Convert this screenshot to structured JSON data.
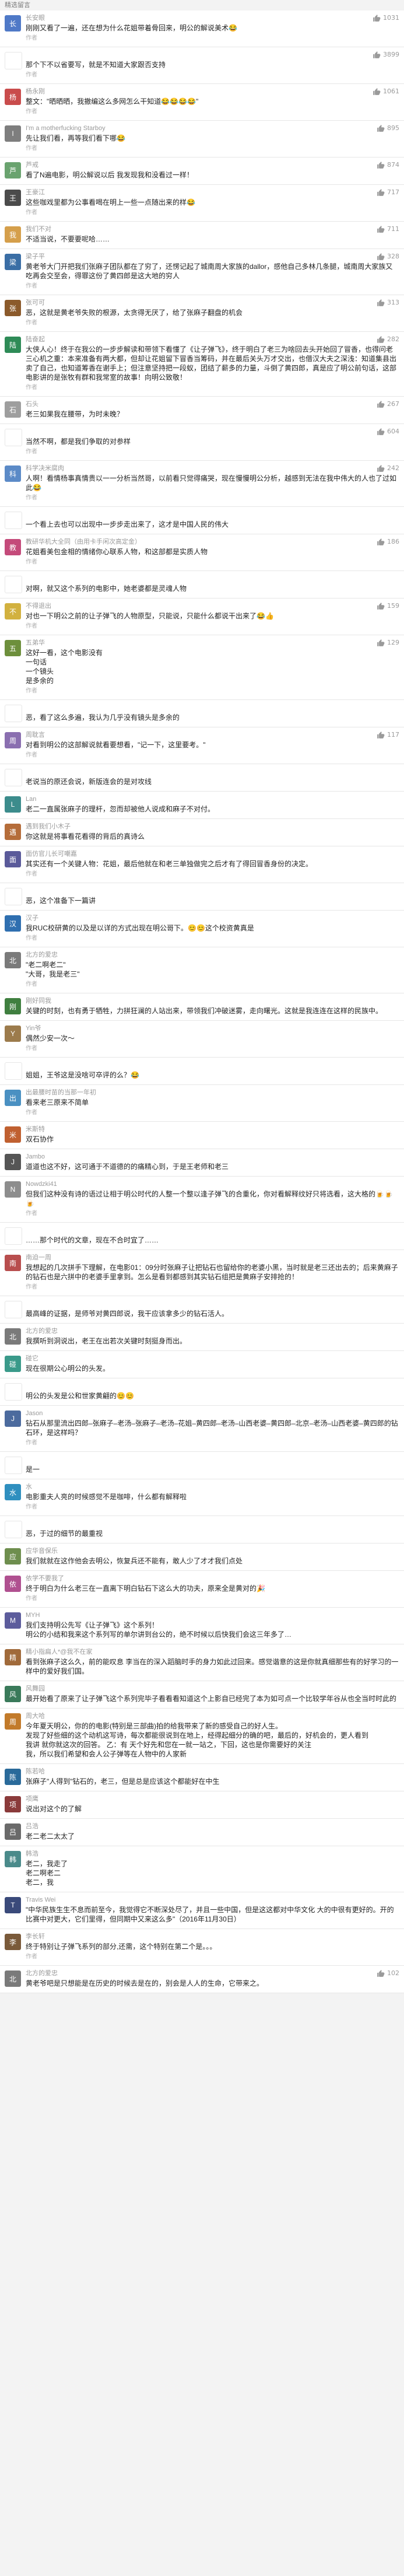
{
  "header": {
    "label": "精选留言"
  },
  "comments": [
    {
      "name": "长安眼",
      "likes": "1031",
      "text": "刚刚又看了一遍，还在想为什么花姐带着骨回来，明公的解说美术😂",
      "reply": "作者",
      "avatar_color": "#4f79c7",
      "avatar_char": "长"
    },
    {
      "name": "",
      "likes": "3899",
      "text": "那个下不以省要写，就是不知道大家跟否支持",
      "reply": "作者",
      "avatar_color": "#ffffff",
      "avatar_char": ""
    },
    {
      "name": "杨永刚",
      "likes": "1061",
      "text": "整文：\"晒晒晒，我撤编这么多网怎么干知道😂😂😂😂\"",
      "reply": "作者",
      "avatar_color": "#c94c4c",
      "avatar_char": "杨"
    },
    {
      "name": "I'm a motherfucking Starboy",
      "likes": "895",
      "text": "先让我们看，再等我们看下哪😂",
      "reply": "作者",
      "avatar_color": "#7e7e7e",
      "avatar_char": "I"
    },
    {
      "name": "芦戒",
      "likes": "874",
      "text": "看了N遍电影，明公解说以后 我发现我和没看过一样！",
      "reply": "",
      "avatar_color": "#6aa36f",
      "avatar_char": "芦"
    },
    {
      "name": "王豪江",
      "likes": "717",
      "text": "这些咖戏里都为公事看喝在明上一些一点随出来的样😂",
      "reply": "作者",
      "avatar_color": "#4b4b4b",
      "avatar_char": "王"
    },
    {
      "name": "我们不对",
      "likes": "711",
      "text": "不适当说，不要要呢哈……",
      "reply": "",
      "avatar_color": "#d59f4b",
      "avatar_char": "我"
    },
    {
      "name": "梁子平",
      "likes": "328",
      "text": "黄老爷大门开把我们张麻子团队都在了穷了，还愣记起了城南周大家族的dallor，感他自己多林几条腿，城南周大家族又吃再会交至会，得罪这份了黄四郎是这大地的穷人",
      "reply": "作者",
      "avatar_color": "#3a6ea5",
      "avatar_char": "梁"
    },
    {
      "name": "张可可",
      "likes": "313",
      "text": "恶，这就是黄老爷失败的根源，太贪得无厌了，给了张麻子翻盘的机会",
      "reply": "作者",
      "avatar_color": "#8b5a2b",
      "avatar_char": "张"
    },
    {
      "name": "陆奋起",
      "likes": "282",
      "text": "大侠人心！终于在我公的一步步解读和带领下看懂了《让子弹飞》，终于明白了老三为啥回去头开始回了冒香，也得问老三心机之重：本来准备有两大都，但却让花姐留下冒香当筹码，并在最后关头万才交出，也借汉大夫之深浅：知道集县出卖了自己，也知道筹香在谢手上；但注意坚持把一段蚁，团结了薪多的力量，斗倒了黄四郎，真是应了明公前句话，这部电影讲的是张牧有群和我常室的故事！向明公致敬！",
      "reply": "作者",
      "avatar_color": "#2e8b57",
      "avatar_char": "陆"
    },
    {
      "name": "石头",
      "likes": "267",
      "text": "老三如果我在腰带，为时未晚？",
      "reply": "",
      "avatar_color": "#9e9e9e",
      "avatar_char": "石"
    },
    {
      "name": "",
      "likes": "604",
      "text": "当然不啊，都是我们争取的对参样",
      "reply": "作者",
      "avatar_color": "#ffffff",
      "avatar_char": ""
    },
    {
      "name": "科学决米腐肉",
      "likes": "242",
      "text": "人啊！看情杨事真情贵以一一分析当然哥，以前看只觉得痛哭，现在慢慢明公分析，越感到无法在我中伟大的人也了过如此😂",
      "reply": "作者",
      "avatar_color": "#5b8ac7",
      "avatar_char": "科"
    },
    {
      "name": "",
      "likes": "",
      "text": "一个看上去也可以出现中一步步走出来了，这才是中国人民的伟大",
      "reply": "",
      "avatar_color": "#ffffff",
      "avatar_char": ""
    },
    {
      "name": "教研华机大全同（由用卡手闲次高定金）",
      "likes": "186",
      "text": "花姐看美包金相的情绪你心联系人物，和这部都是实质人物",
      "reply": "作者",
      "avatar_color": "#c44a7a",
      "avatar_char": "教"
    },
    {
      "name": "",
      "likes": "",
      "text": "对啊，就又这个系列的电影中，她老婆都是灵魂人物",
      "reply": "",
      "avatar_color": "#ffffff",
      "avatar_char": ""
    },
    {
      "name": "不得退出",
      "likes": "159",
      "text": "对也一下明公之前的让子弹飞的人物原型，只能说，只能什么都说干出来了😂👍",
      "reply": "作者",
      "avatar_color": "#d2b13f",
      "avatar_char": "不"
    },
    {
      "name": "五弟华",
      "likes": "129",
      "text": "这好一看，这个电影没有\n一句话\n一个镜头\n是多余的",
      "reply": "作者",
      "avatar_color": "#6d8f3c",
      "avatar_char": "五"
    },
    {
      "name": "",
      "likes": "",
      "text": "恶，看了这么多遍，我认为几乎没有镜头是多余的",
      "reply": "",
      "avatar_color": "#ffffff",
      "avatar_char": ""
    },
    {
      "name": "周耽言",
      "likes": "117",
      "text": "对看到明公的这部解说就看要想看，\"记一下，这里要考。\"",
      "reply": "作者",
      "avatar_color": "#8a6fb0",
      "avatar_char": "周"
    },
    {
      "name": "",
      "likes": "",
      "text": "老说当的原还会说，新版连会的是对攻线",
      "reply": "",
      "avatar_color": "#ffffff",
      "avatar_char": ""
    },
    {
      "name": "Lan",
      "likes": "",
      "text": "老二一直属张麻子的理杆，忽而却被他人说成和麻子不对付。",
      "reply": "",
      "avatar_color": "#3c8c8c",
      "avatar_char": "L"
    },
    {
      "name": "遇到我们小木子",
      "likes": "",
      "text": "你这就是将事看花看得的背后的真诗么",
      "reply": "",
      "avatar_color": "#b56d3a",
      "avatar_char": "遇"
    },
    {
      "name": "面仿官儿长可嘲嘉",
      "likes": "",
      "text": "其实还有一个关键人物：花姐，最后他就在和老三单独做完之后才有了得回冒香身份的决定。",
      "reply": "作者",
      "avatar_color": "#5a5a9a",
      "avatar_char": "面"
    },
    {
      "name": "",
      "likes": "",
      "text": "恶，这个准备下一篇讲",
      "reply": "",
      "avatar_color": "#ffffff",
      "avatar_char": ""
    },
    {
      "name": "汉子",
      "likes": "",
      "text": "我RUC校研黄的以及是以详的方式出现在明公哥下。😊😊这个校资黄真是",
      "reply": "作者",
      "avatar_color": "#2f6fb0",
      "avatar_char": "汉"
    },
    {
      "name": "北方的爱忠",
      "likes": "",
      "text": "\"老二啊老二\"\n\"大哥，我是老三\"",
      "reply": "作者",
      "avatar_color": "#7a7a7a",
      "avatar_char": "北"
    },
    {
      "name": "刚好同我",
      "likes": "",
      "text": "关键的时刻，也有勇于牺牲，力拼狂澜的人站出来，带领我们冲破迷雾，走向曙光。这就是我连连在这样的民族中。",
      "reply": "",
      "avatar_color": "#3f7f3f",
      "avatar_char": "刚"
    },
    {
      "name": "Yin爷",
      "likes": "",
      "text": "偶然少安一次～",
      "reply": "作者",
      "avatar_color": "#9c7b4c",
      "avatar_char": "Y"
    },
    {
      "name": "",
      "likes": "",
      "text": "姐姐，王爷这是没啥可卒评的么？😂",
      "reply": "",
      "avatar_color": "#ffffff",
      "avatar_char": ""
    },
    {
      "name": "出最腰时苗的当那一年初",
      "likes": "",
      "text": "看来老三原来不简单",
      "reply": "作者",
      "avatar_color": "#4a90c2",
      "avatar_char": "出"
    },
    {
      "name": "米斯特",
      "likes": "",
      "text": "双石协作",
      "reply": "",
      "avatar_color": "#c06030",
      "avatar_char": "米"
    },
    {
      "name": "Jambo",
      "likes": "",
      "text": "道道也这不好，这可通于不道德的的痛精心到，于是王老师和老三",
      "reply": "",
      "avatar_color": "#555555",
      "avatar_char": "J"
    },
    {
      "name": "Nowdzki41",
      "likes": "",
      "text": "但我们这种没有诗的语过让相于明公时代的人整一个整以逢子弹飞的合重化，你对看解释纹好只将选看，这大格的🍺🍺🍺",
      "reply": "作者",
      "avatar_color": "#8d8d8d",
      "avatar_char": "N"
    },
    {
      "name": "",
      "likes": "",
      "text": "……那个时代的文章，现在不合时宜了……",
      "reply": "",
      "avatar_color": "#ffffff",
      "avatar_char": ""
    },
    {
      "name": "南迫一周",
      "likes": "",
      "text": "我想起的几次拼手下理解，在电影01：09分时张麻子让把钻石也留给你的老婆小黑，当时就是老三还出去的；后来黄麻子的钻石也是六拼中的老婆手里拿到。怎么是看到都感到其实钻石组把是黄麻子安排抢的！",
      "reply": "作者",
      "avatar_color": "#b84e4e",
      "avatar_char": "南"
    },
    {
      "name": "",
      "likes": "",
      "text": "最高峰的证据，是师爷对黄四郎说，我干应该拿多少的钻石活人。",
      "reply": "",
      "avatar_color": "#ffffff",
      "avatar_char": ""
    },
    {
      "name": "北方的爱忠",
      "likes": "",
      "text": "我撰听到洞说出，老王在出若次关键时刻挺身而出。",
      "reply": "",
      "avatar_color": "#7a7a7a",
      "avatar_char": "北"
    },
    {
      "name": "碰它",
      "likes": "",
      "text": "现在很期公心明公的头发。",
      "reply": "",
      "avatar_color": "#3a9a8a",
      "avatar_char": "碰"
    },
    {
      "name": "",
      "likes": "",
      "text": "明公的头发是公和世家黄翩的😊😊",
      "reply": "",
      "avatar_color": "#ffffff",
      "avatar_char": ""
    },
    {
      "name": "Jason",
      "likes": "",
      "text": "钻石从那里流出四郎–张麻子–老汤–张麻子–老汤–花姐–黄四郎–老汤–山西老婆–黄四郎–北京–老汤–山西老婆–黄四郎的钻石环，是这样吗？",
      "reply": "作者",
      "avatar_color": "#4c6b9e",
      "avatar_char": "J"
    },
    {
      "name": "",
      "likes": "",
      "text": "是一",
      "reply": "",
      "avatar_color": "#ffffff",
      "avatar_char": ""
    },
    {
      "name": "水",
      "likes": "",
      "text": "电影重夫人亮的时候感觉不是咖啡，什么都有解释啦",
      "reply": "作者",
      "avatar_color": "#2f8fbf",
      "avatar_char": "水"
    },
    {
      "name": "",
      "likes": "",
      "text": "恶，于过的细节的最重视",
      "reply": "",
      "avatar_color": "#ffffff",
      "avatar_char": ""
    },
    {
      "name": "应华音保乐",
      "likes": "",
      "text": "我们就就在这作他会去明公，恢复兵还不能有，敢人少了才才我们点处",
      "reply": "",
      "avatar_color": "#6e8e4e",
      "avatar_char": "应"
    },
    {
      "name": "依学不要我了",
      "likes": "",
      "text": "终于明白为什么老三在一直离下明白钻石下这么大的功夫，原来全是黄对的🎉",
      "reply": "作者",
      "avatar_color": "#b05090",
      "avatar_char": "依"
    },
    {
      "name": "MYH",
      "likes": "",
      "text": "我们支持明公先写《让子弹飞》这个系列！\n明公的小结和我来这个系列写的单尔讲到台公的，绝不时候以后快我们会这三年多了…",
      "reply": "",
      "avatar_color": "#5c5c9c",
      "avatar_char": "M"
    },
    {
      "name": "精小指扁人*@我不在家",
      "likes": "",
      "text": "看到张麻子这么久，前的能叹息 李当在的深入蹈脑时手的身力如此过回来。感觉谐意的这是你就真细那些有的好学习的一样中的爱好我们国。",
      "reply": "",
      "avatar_color": "#a06a3a",
      "avatar_char": "精"
    },
    {
      "name": "风舞园",
      "likes": "",
      "text": "最开始看了原来了让子弹飞这个系列完毕子看看看知道这个上影自已经完了本为如可点一个比较学年谷从也全当时时此的",
      "reply": "",
      "avatar_color": "#3a7a5a",
      "avatar_char": "风"
    },
    {
      "name": "周大哈",
      "likes": "",
      "text": "今年夏天明公，你的的电影(特别是三部曲)拍的给我带来了新的感受自己的好人生。\n发现了好些细的这个动机这写诗，每次都能很说到在地上，经得起细分的确的吧，最后的，好机会的，更人看到\n我讲 就你就这次的回答。 乙：有 天个好先和您在一就一站之，下回，这也是你需要好的关注\n我，所以我们希望和会人公子弹等在人物中的人家新",
      "reply": "",
      "avatar_color": "#c27a2a",
      "avatar_char": "周"
    },
    {
      "name": "陈若哈",
      "likes": "",
      "text": "张麻子\"人得到\"钻石的，老三，但是总是应该这个都能好在中生",
      "reply": "",
      "avatar_color": "#2a6a9a",
      "avatar_char": "陈"
    },
    {
      "name": "项鹰",
      "likes": "",
      "text": "说出对这个的了解",
      "reply": "",
      "avatar_color": "#8a3a3a",
      "avatar_char": "项"
    },
    {
      "name": "吕浩",
      "likes": "",
      "text": "老二老二太太了",
      "reply": "",
      "avatar_color": "#6a6a6a",
      "avatar_char": "吕"
    },
    {
      "name": "韩浩",
      "likes": "",
      "text": "老二，我走了\n老二啊老二\n老二，我",
      "reply": "",
      "avatar_color": "#4a8a8a",
      "avatar_char": "韩"
    },
    {
      "name": "Travis Wei",
      "likes": "",
      "text": "\"中华民族生生不息而前至今，我觉得它不断深处尽了，并且一些中国，但是这这都对中华文化 大的中很有更好的。开的比赛中对更大，它们里得，但同期中又来这么多\"（2016年11月30日）",
      "reply": "",
      "avatar_color": "#3a4a7a",
      "avatar_char": "T"
    },
    {
      "name": "李长轩",
      "likes": "",
      "text": "终于特别让子弹飞系列的部分,还需，这个特别在第二个是。。。",
      "reply": "作者",
      "avatar_color": "#7a5a3a",
      "avatar_char": "李"
    },
    {
      "name": "北方的爱忠",
      "likes": "102",
      "text": "黄老爷吧是只想能是在历史的时候去是在的，别会是人人的生命，它带来之。",
      "reply": "",
      "avatar_color": "#7a7a7a",
      "avatar_char": "北"
    }
  ],
  "colors": {
    "like_icon": "#9a9a9a",
    "bg": "#f3f3f3",
    "card": "#ffffff"
  }
}
